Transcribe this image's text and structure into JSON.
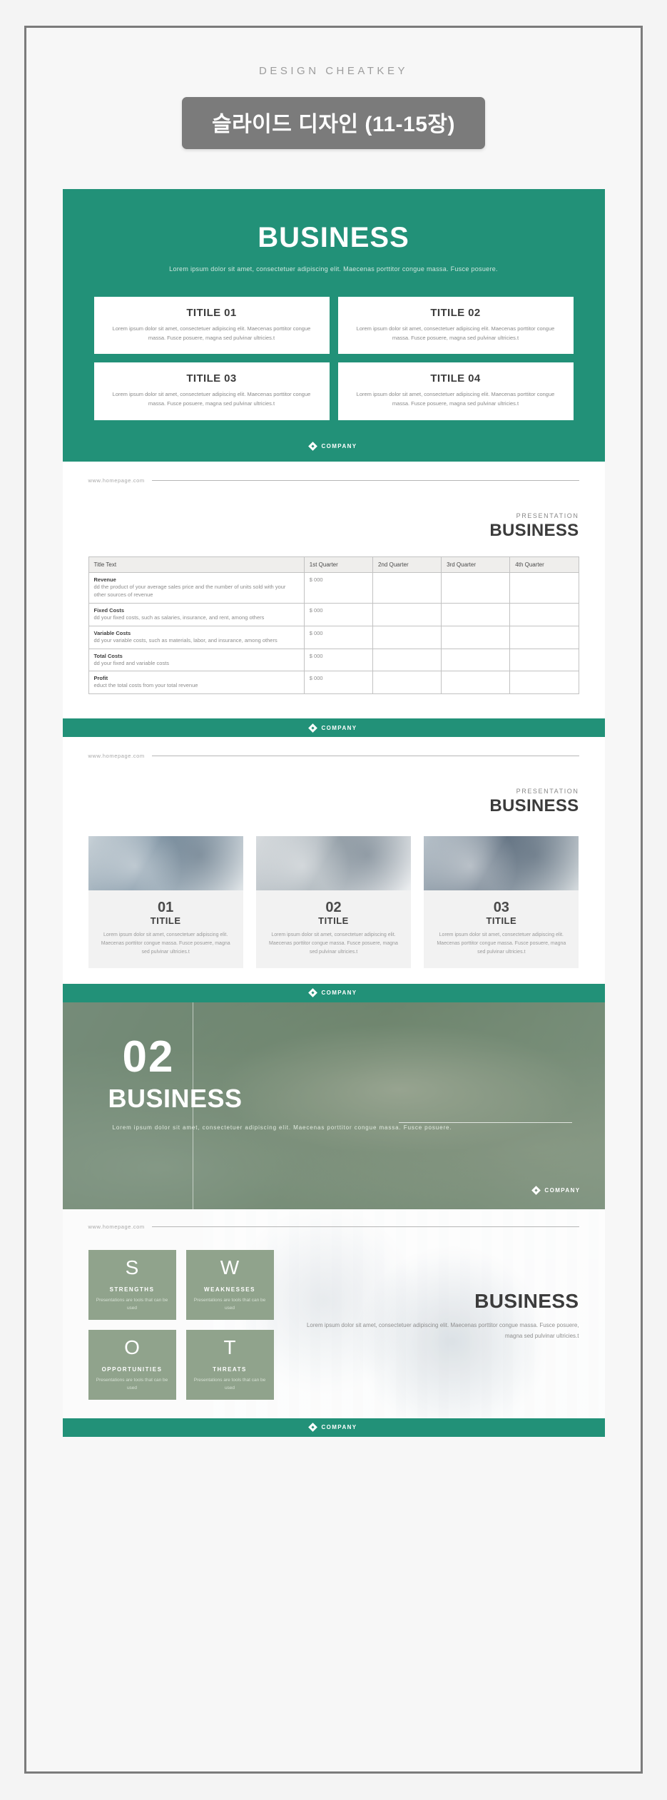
{
  "header": {
    "kicker": "DESIGN CHEATKEY",
    "banner": "슬라이드 디자인 (11-15장)"
  },
  "colors": {
    "green": "#229178",
    "sage": "#90a38c",
    "banner_gray": "#7b7b7b"
  },
  "common": {
    "company_label": "COMPANY",
    "url": "www.homepage.com",
    "presentation_kicker": "PRESENTATION",
    "presentation_title": "BUSINESS"
  },
  "slide_cover": {
    "title": "BUSINESS",
    "subtitle": "Lorem ipsum dolor sit amet, consectetuer adipiscing elit. Maecenas porttitor congue massa. Fusce posuere.",
    "cards": [
      {
        "title": "TITILE 01",
        "body": "Lorem ipsum dolor sit amet, consectetuer adipiscing elit. Maecenas porttitor congue massa. Fusce posuere, magna sed pulvinar ultricies.t"
      },
      {
        "title": "TITILE 02",
        "body": "Lorem ipsum dolor sit amet, consectetuer adipiscing elit. Maecenas porttitor congue massa. Fusce posuere, magna sed pulvinar ultricies.t"
      },
      {
        "title": "TITILE 03",
        "body": "Lorem ipsum dolor sit amet, consectetuer adipiscing elit. Maecenas porttitor congue massa. Fusce posuere, magna sed pulvinar ultricies.t"
      },
      {
        "title": "TITILE 04",
        "body": "Lorem ipsum dolor sit amet, consectetuer adipiscing elit. Maecenas porttitor congue massa. Fusce posuere, magna sed pulvinar ultricies.t"
      }
    ]
  },
  "slide_table": {
    "columns": [
      "Title Text",
      "1st Quarter",
      "2nd Quarter",
      "3rd Quarter",
      "4th Quarter"
    ],
    "rows": [
      {
        "name": "Revenue",
        "desc": "dd the product of your average sales price and the number of units sold with your other sources of revenue",
        "q1": "$ 000",
        "q2": "",
        "q3": "",
        "q4": ""
      },
      {
        "name": "Fixed Costs",
        "desc": "dd your fixed costs, such as salaries, insurance, and rent, among others",
        "q1": "$ 000",
        "q2": "",
        "q3": "",
        "q4": ""
      },
      {
        "name": "Variable Costs",
        "desc": "dd your variable costs, such as materials, labor, and insurance, among others",
        "q1": "$ 000",
        "q2": "",
        "q3": "",
        "q4": ""
      },
      {
        "name": "Total Costs",
        "desc": "dd your fixed and variable costs",
        "q1": "$ 000",
        "q2": "",
        "q3": "",
        "q4": ""
      },
      {
        "name": "Profit",
        "desc": "educt the total costs from your total revenue",
        "q1": "$ 000",
        "q2": "",
        "q3": "",
        "q4": ""
      }
    ]
  },
  "slide_photos": {
    "cards": [
      {
        "number": "01",
        "title": "TITILE",
        "body": "Lorem ipsum dolor sit amet, consectetuer adipiscing elit. Maecenas porttitor congue massa. Fusce posuere, magna sed pulvinar ultricies.t",
        "photo": "meeting-photo"
      },
      {
        "number": "02",
        "title": "TITILE",
        "body": "Lorem ipsum dolor sit amet, consectetuer adipiscing elit. Maecenas porttitor congue massa. Fusce posuere, magna sed pulvinar ultricies.t",
        "photo": "desk-photo"
      },
      {
        "number": "03",
        "title": "TITILE",
        "body": "Lorem ipsum dolor sit amet, consectetuer adipiscing elit. Maecenas porttitor congue massa. Fusce posuere, magna sed pulvinar ultricies.t",
        "photo": "team-photo"
      }
    ]
  },
  "slide_section": {
    "number": "02",
    "title": "BUSINESS",
    "subtitle": "Lorem ipsum dolor sit amet, consectetuer adipiscing elit. Maecenas porttitor congue massa. Fusce posuere.",
    "company_label": "COMPANY"
  },
  "slide_swot": {
    "boxes": [
      {
        "letter": "S",
        "name": "STRENGTHS",
        "desc": "Presentations are tools that can be used"
      },
      {
        "letter": "W",
        "name": "WEAKNESSES",
        "desc": "Presentations are tools that can be used"
      },
      {
        "letter": "O",
        "name": "OPPORTUNITIES",
        "desc": "Presentations are tools that can be used"
      },
      {
        "letter": "T",
        "name": "THREATS",
        "desc": "Presentations are tools that can be used"
      }
    ],
    "title": "BUSINESS",
    "body": "Lorem ipsum dolor sit amet, consectetuer adipiscing elit. Maecenas porttitor congue massa. Fusce posuere, magna sed pulvinar ultricies.t"
  }
}
